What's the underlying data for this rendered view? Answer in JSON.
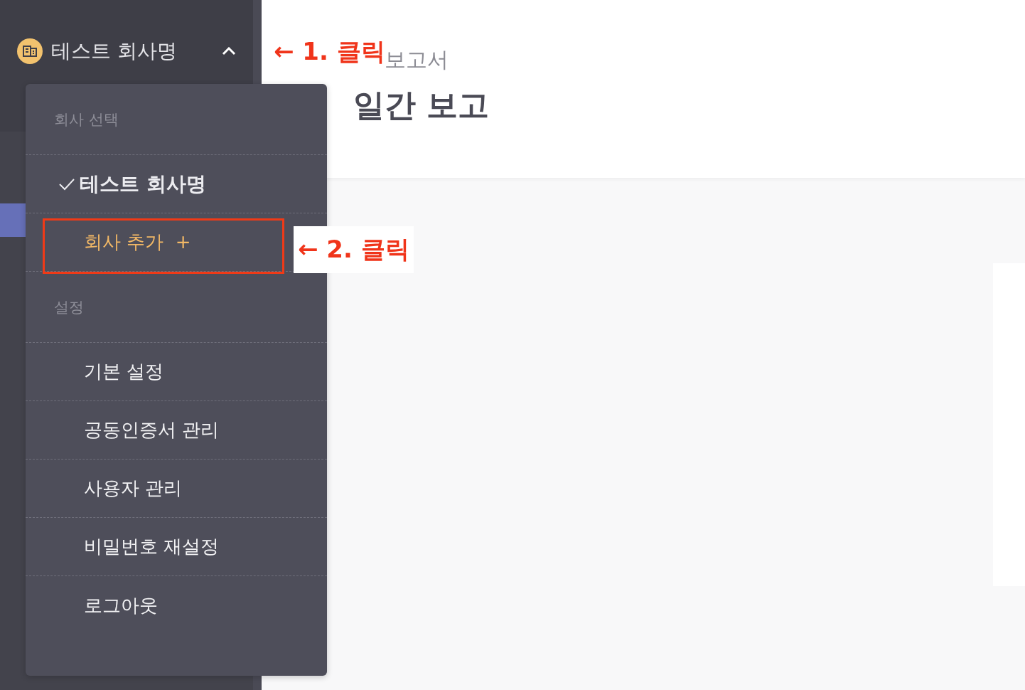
{
  "sidebar": {
    "company": {
      "name": "테스트 회사명",
      "expanded": true
    }
  },
  "menu": {
    "sections": [
      {
        "title": "회사 선택",
        "items": [
          {
            "kind": "option",
            "label": "테스트 회사명",
            "selected": true
          },
          {
            "kind": "add",
            "label": "회사 추가",
            "icon_text": "+"
          }
        ]
      },
      {
        "title": "설정",
        "items": [
          {
            "kind": "link",
            "label": "기본 설정"
          },
          {
            "kind": "link",
            "label": "공동인증서 관리"
          },
          {
            "kind": "link",
            "label": "사용자 관리"
          },
          {
            "kind": "link",
            "label": "비밀번호 재설정"
          },
          {
            "kind": "link",
            "label": "로그아웃"
          }
        ]
      }
    ]
  },
  "page": {
    "breadcrumb": "보고서",
    "title": "일간 보고"
  },
  "annotations": [
    {
      "text": "← 1. 클릭"
    },
    {
      "text": "← 2. 클릭"
    }
  ]
}
